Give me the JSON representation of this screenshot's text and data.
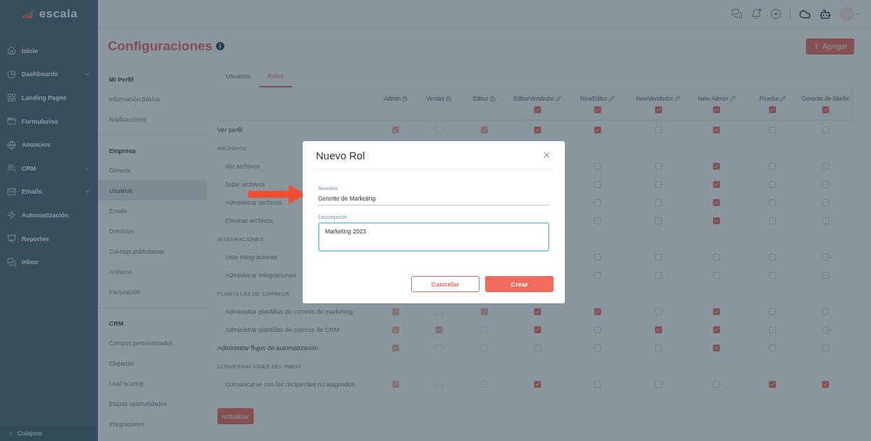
{
  "sidebar": {
    "logo": "escala",
    "items": [
      {
        "label": "Inicio",
        "expandable": false
      },
      {
        "label": "Dashboards",
        "expandable": true
      },
      {
        "label": "Landing Pages",
        "expandable": false
      },
      {
        "label": "Formularios",
        "expandable": false
      },
      {
        "label": "Anuncios",
        "expandable": false
      },
      {
        "label": "CRM",
        "expandable": true
      },
      {
        "label": "Emails",
        "expandable": true
      },
      {
        "label": "Automatización",
        "expandable": false
      },
      {
        "label": "Reportes",
        "expandable": false
      },
      {
        "label": "Inbox",
        "expandable": false
      }
    ],
    "collapse": "Colapsar"
  },
  "top_bar": {
    "notification_dot": true
  },
  "page": {
    "title": "Configuraciones",
    "add_button": "Agregar"
  },
  "settings_nav": [
    {
      "heading": "Mi Perfil",
      "items": [
        {
          "label": "Información Básica",
          "selected": false
        },
        {
          "label": "Notificaciones",
          "selected": false
        }
      ]
    },
    {
      "heading": "Empresa",
      "items": [
        {
          "label": "General",
          "selected": false
        },
        {
          "label": "Usuarios",
          "selected": true
        },
        {
          "label": "Emails",
          "selected": false
        },
        {
          "label": "Dominios",
          "selected": false
        },
        {
          "label": "Cuentas publicitarias",
          "selected": false
        },
        {
          "label": "Archivos",
          "selected": false
        },
        {
          "label": "Facturación",
          "selected": false
        }
      ]
    },
    {
      "heading": "CRM",
      "items": [
        {
          "label": "Campos personalizados",
          "selected": false
        },
        {
          "label": "Etiquetas",
          "selected": false
        },
        {
          "label": "Lead scoring",
          "selected": false
        },
        {
          "label": "Etapas oportunidades",
          "selected": false
        },
        {
          "label": "Integraciones",
          "selected": false
        }
      ]
    }
  ],
  "tabs": [
    {
      "label": "Usuarios",
      "selected": false
    },
    {
      "label": "Roles",
      "selected": true
    }
  ],
  "roles_table": {
    "columns": [
      {
        "name": "Admin",
        "locked": true
      },
      {
        "name": "Ventas",
        "locked": true
      },
      {
        "name": "Editor",
        "locked": true
      },
      {
        "name": "EditorVendedor",
        "locked": false,
        "all_checked": true
      },
      {
        "name": "NewEditor",
        "locked": false,
        "all_checked": true
      },
      {
        "name": "NewVendedor",
        "locked": false,
        "all_checked": true
      },
      {
        "name": "New Admin",
        "locked": false,
        "all_checked": true
      },
      {
        "name": "Prueba",
        "locked": false,
        "all_checked": true
      },
      {
        "name": "Gerente de Marke",
        "all_checked": true
      }
    ],
    "rows": [
      {
        "kind": "top",
        "label": "Ver perfil",
        "cells": [
          {
            "checked": true
          },
          {
            "checked": false
          },
          {
            "checked": true
          },
          {
            "checked": true
          },
          {
            "checked": true
          },
          {
            "checked": false
          },
          {
            "checked": true
          },
          {
            "checked": false
          },
          {
            "checked": false
          }
        ]
      },
      {
        "kind": "section",
        "label": "ARCHIVOS"
      },
      {
        "kind": "item",
        "label": "Ver archivos",
        "cells": [
          null,
          null,
          null,
          null,
          {
            "checked": false
          },
          {
            "checked": false
          },
          {
            "checked": true
          },
          {
            "checked": false
          },
          {
            "checked": false
          }
        ]
      },
      {
        "kind": "item",
        "label": "Subir archivos",
        "cells": [
          null,
          null,
          null,
          null,
          {
            "checked": false
          },
          {
            "checked": false
          },
          {
            "checked": true
          },
          {
            "checked": false
          },
          {
            "checked": false
          }
        ]
      },
      {
        "kind": "item",
        "label": "Administrar archivos",
        "cells": [
          null,
          null,
          null,
          null,
          {
            "checked": false
          },
          {
            "checked": false
          },
          {
            "checked": true
          },
          {
            "checked": false
          },
          {
            "checked": false
          }
        ]
      },
      {
        "kind": "item",
        "label": "Eliminar archivos",
        "cells": [
          null,
          null,
          null,
          null,
          {
            "checked": false
          },
          {
            "checked": false
          },
          {
            "checked": true
          },
          {
            "checked": false
          },
          {
            "checked": false
          }
        ]
      },
      {
        "kind": "section",
        "label": "INTEGRACIONES"
      },
      {
        "kind": "item",
        "label": "Usar integraciones",
        "cells": [
          null,
          null,
          null,
          null,
          {
            "checked": false
          },
          {
            "checked": false
          },
          {
            "checked": false
          },
          {
            "checked": false
          },
          {
            "checked": false
          }
        ]
      },
      {
        "kind": "item",
        "label": "Administrar integraciones",
        "cells": [
          null,
          null,
          null,
          null,
          {
            "checked": false
          },
          {
            "checked": false
          },
          {
            "checked": false
          },
          {
            "checked": false
          },
          {
            "checked": false
          }
        ]
      },
      {
        "kind": "section",
        "label": "PLANTILLAS DE CORREOS"
      },
      {
        "kind": "item",
        "label": "Administrar plantillas de correos de marketing",
        "cells": [
          {
            "checked": true
          },
          {
            "checked": false
          },
          {
            "checked": true
          },
          {
            "checked": true
          },
          {
            "checked": true
          },
          {
            "checked": false
          },
          {
            "checked": true
          },
          {
            "checked": false
          },
          {
            "checked": false
          }
        ]
      },
      {
        "kind": "item",
        "label": "Administrar plantillas de correos de CRM",
        "cells": [
          {
            "checked": true
          },
          {
            "checked": true
          },
          {
            "checked": false
          },
          {
            "checked": true
          },
          {
            "checked": false
          },
          {
            "checked": true
          },
          {
            "checked": true
          },
          {
            "checked": false
          },
          {
            "checked": false
          }
        ]
      },
      {
        "kind": "top",
        "label": "Administrar flujos de automatización",
        "cells": [
          {
            "checked": true
          },
          {
            "checked": false
          },
          {
            "checked": false
          },
          {
            "checked": false
          },
          {
            "checked": false
          },
          {
            "checked": false
          },
          {
            "checked": true
          },
          {
            "checked": false
          },
          {
            "checked": false
          }
        ]
      },
      {
        "kind": "section",
        "label": "CONVERSACIONES DEL INBOX"
      },
      {
        "kind": "item",
        "label": "Comunicarse con los recipientes no asignados",
        "cells": [
          {
            "checked": true
          },
          {
            "checked": false
          },
          {
            "checked": false
          },
          {
            "checked": true
          },
          {
            "checked": false
          },
          {
            "checked": false
          },
          {
            "checked": false
          },
          {
            "checked": true
          },
          {
            "checked": true
          }
        ]
      }
    ],
    "update_button": "Actualizar"
  },
  "modal": {
    "title": "Nuevo Rol",
    "fields": [
      {
        "kind": "line",
        "label": "Nombre",
        "value": "Gerente de Marketing",
        "focused": false
      },
      {
        "kind": "textarea",
        "label": "Descripción",
        "value": "Marketing 2023",
        "focused": true
      }
    ],
    "buttons": [
      {
        "kind": "secondary",
        "label": "Cancelar"
      },
      {
        "kind": "primary",
        "label": "Crear"
      }
    ]
  }
}
